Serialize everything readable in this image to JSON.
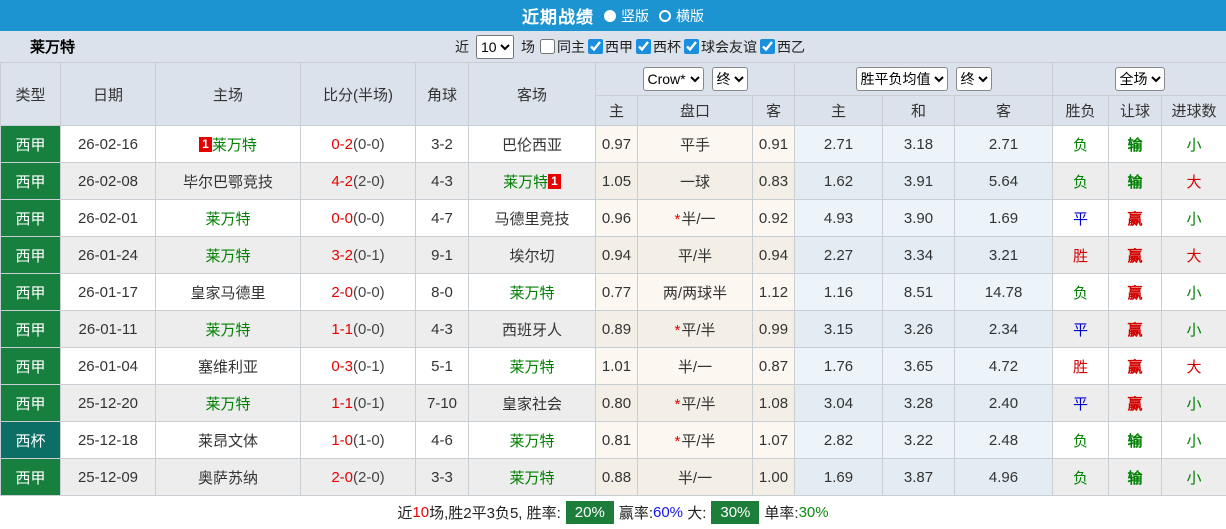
{
  "title_bar": {
    "title": "近期战绩",
    "layout_options": [
      {
        "label": "竖版",
        "selected": true
      },
      {
        "label": "横版",
        "selected": false
      }
    ]
  },
  "filter_bar": {
    "team": "莱万特",
    "recent_label": "近",
    "count_value": "10",
    "matches_label": "场",
    "filters": [
      {
        "label": "同主",
        "checked": false
      },
      {
        "label": "西甲",
        "checked": true
      },
      {
        "label": "西杯",
        "checked": true
      },
      {
        "label": "球会友谊",
        "checked": true
      },
      {
        "label": "西乙",
        "checked": true
      }
    ]
  },
  "table": {
    "static_headers": [
      "类型",
      "日期",
      "主场",
      "比分(半场)",
      "角球",
      "客场"
    ],
    "odds_group": {
      "selects": [
        "Crow*",
        "终"
      ],
      "columns": [
        "主",
        "盘口",
        "客"
      ]
    },
    "avg_group": {
      "selects": [
        "胜平负均值",
        "终"
      ],
      "columns": [
        "主",
        "和",
        "客"
      ]
    },
    "result_group": {
      "selects": [
        "全场"
      ],
      "columns": [
        "胜负",
        "让球",
        "进球数"
      ]
    },
    "rows": [
      {
        "league": "西甲",
        "league_color": "green",
        "date": "26-02-16",
        "home": {
          "name": "莱万特",
          "focus": true,
          "badge": "1",
          "badge_pos": "before"
        },
        "score": {
          "full": "0-2",
          "half": "(0-0)"
        },
        "corner": "3-2",
        "away": {
          "name": "巴伦西亚",
          "focus": false
        },
        "odds": {
          "home": "0.97",
          "star": false,
          "handicap": "平手",
          "away": "0.91"
        },
        "avg": {
          "home": "2.71",
          "draw": "3.18",
          "away": "2.71"
        },
        "outcome": {
          "text": "负",
          "color": "green"
        },
        "handicap_result": {
          "text": "输",
          "color": "green"
        },
        "goals_result": {
          "text": "小",
          "color": "green"
        }
      },
      {
        "league": "西甲",
        "league_color": "green",
        "date": "26-02-08",
        "home": {
          "name": "毕尔巴鄂竞技",
          "focus": false
        },
        "score": {
          "full": "4-2",
          "half": "(2-0)"
        },
        "corner": "4-3",
        "away": {
          "name": "莱万特",
          "focus": true,
          "badge": "1",
          "badge_pos": "after"
        },
        "odds": {
          "home": "1.05",
          "star": false,
          "handicap": "一球",
          "away": "0.83"
        },
        "avg": {
          "home": "1.62",
          "draw": "3.91",
          "away": "5.64"
        },
        "outcome": {
          "text": "负",
          "color": "green"
        },
        "handicap_result": {
          "text": "输",
          "color": "green"
        },
        "goals_result": {
          "text": "大",
          "color": "red"
        }
      },
      {
        "league": "西甲",
        "league_color": "green",
        "date": "26-02-01",
        "home": {
          "name": "莱万特",
          "focus": true
        },
        "score": {
          "full": "0-0",
          "half": "(0-0)"
        },
        "corner": "4-7",
        "away": {
          "name": "马德里竞技",
          "focus": false
        },
        "odds": {
          "home": "0.96",
          "star": true,
          "handicap": "半/一",
          "away": "0.92"
        },
        "avg": {
          "home": "4.93",
          "draw": "3.90",
          "away": "1.69"
        },
        "outcome": {
          "text": "平",
          "color": "blue"
        },
        "handicap_result": {
          "text": "赢",
          "color": "red"
        },
        "goals_result": {
          "text": "小",
          "color": "green"
        }
      },
      {
        "league": "西甲",
        "league_color": "green",
        "date": "26-01-24",
        "home": {
          "name": "莱万特",
          "focus": true
        },
        "score": {
          "full": "3-2",
          "half": "(0-1)"
        },
        "corner": "9-1",
        "away": {
          "name": "埃尔切",
          "focus": false
        },
        "odds": {
          "home": "0.94",
          "star": false,
          "handicap": "平/半",
          "away": "0.94"
        },
        "avg": {
          "home": "2.27",
          "draw": "3.34",
          "away": "3.21"
        },
        "outcome": {
          "text": "胜",
          "color": "red"
        },
        "handicap_result": {
          "text": "赢",
          "color": "red"
        },
        "goals_result": {
          "text": "大",
          "color": "red"
        }
      },
      {
        "league": "西甲",
        "league_color": "green",
        "date": "26-01-17",
        "home": {
          "name": "皇家马德里",
          "focus": false
        },
        "score": {
          "full": "2-0",
          "half": "(0-0)"
        },
        "corner": "8-0",
        "away": {
          "name": "莱万特",
          "focus": true
        },
        "odds": {
          "home": "0.77",
          "star": false,
          "handicap": "两/两球半",
          "away": "1.12"
        },
        "avg": {
          "home": "1.16",
          "draw": "8.51",
          "away": "14.78"
        },
        "outcome": {
          "text": "负",
          "color": "green"
        },
        "handicap_result": {
          "text": "赢",
          "color": "red"
        },
        "goals_result": {
          "text": "小",
          "color": "green"
        }
      },
      {
        "league": "西甲",
        "league_color": "green",
        "date": "26-01-11",
        "home": {
          "name": "莱万特",
          "focus": true
        },
        "score": {
          "full": "1-1",
          "half": "(0-0)"
        },
        "corner": "4-3",
        "away": {
          "name": "西班牙人",
          "focus": false
        },
        "odds": {
          "home": "0.89",
          "star": true,
          "handicap": "平/半",
          "away": "0.99"
        },
        "avg": {
          "home": "3.15",
          "draw": "3.26",
          "away": "2.34"
        },
        "outcome": {
          "text": "平",
          "color": "blue"
        },
        "handicap_result": {
          "text": "赢",
          "color": "red"
        },
        "goals_result": {
          "text": "小",
          "color": "green"
        }
      },
      {
        "league": "西甲",
        "league_color": "green",
        "date": "26-01-04",
        "home": {
          "name": "塞维利亚",
          "focus": false
        },
        "score": {
          "full": "0-3",
          "half": "(0-1)"
        },
        "corner": "5-1",
        "away": {
          "name": "莱万特",
          "focus": true
        },
        "odds": {
          "home": "1.01",
          "star": false,
          "handicap": "半/一",
          "away": "0.87"
        },
        "avg": {
          "home": "1.76",
          "draw": "3.65",
          "away": "4.72"
        },
        "outcome": {
          "text": "胜",
          "color": "red"
        },
        "handicap_result": {
          "text": "赢",
          "color": "red"
        },
        "goals_result": {
          "text": "大",
          "color": "red"
        }
      },
      {
        "league": "西甲",
        "league_color": "green",
        "date": "25-12-20",
        "home": {
          "name": "莱万特",
          "focus": true
        },
        "score": {
          "full": "1-1",
          "half": "(0-1)"
        },
        "corner": "7-10",
        "away": {
          "name": "皇家社会",
          "focus": false
        },
        "odds": {
          "home": "0.80",
          "star": true,
          "handicap": "平/半",
          "away": "1.08"
        },
        "avg": {
          "home": "3.04",
          "draw": "3.28",
          "away": "2.40"
        },
        "outcome": {
          "text": "平",
          "color": "blue"
        },
        "handicap_result": {
          "text": "赢",
          "color": "red"
        },
        "goals_result": {
          "text": "小",
          "color": "green"
        }
      },
      {
        "league": "西杯",
        "league_color": "teal",
        "date": "25-12-18",
        "home": {
          "name": "莱昂文体",
          "focus": false
        },
        "score": {
          "full": "1-0",
          "half": "(1-0)"
        },
        "corner": "4-6",
        "away": {
          "name": "莱万特",
          "focus": true
        },
        "odds": {
          "home": "0.81",
          "star": true,
          "handicap": "平/半",
          "away": "1.07"
        },
        "avg": {
          "home": "2.82",
          "draw": "3.22",
          "away": "2.48"
        },
        "outcome": {
          "text": "负",
          "color": "green"
        },
        "handicap_result": {
          "text": "输",
          "color": "green"
        },
        "goals_result": {
          "text": "小",
          "color": "green"
        }
      },
      {
        "league": "西甲",
        "league_color": "green",
        "date": "25-12-09",
        "home": {
          "name": "奥萨苏纳",
          "focus": false
        },
        "score": {
          "full": "2-0",
          "half": "(2-0)"
        },
        "corner": "3-3",
        "away": {
          "name": "莱万特",
          "focus": true
        },
        "odds": {
          "home": "0.88",
          "star": false,
          "handicap": "半/一",
          "away": "1.00"
        },
        "avg": {
          "home": "1.69",
          "draw": "3.87",
          "away": "4.96"
        },
        "outcome": {
          "text": "负",
          "color": "green"
        },
        "handicap_result": {
          "text": "输",
          "color": "green"
        },
        "goals_result": {
          "text": "小",
          "color": "green"
        }
      }
    ]
  },
  "summary": {
    "segments": [
      {
        "text": "近"
      },
      {
        "text": "10",
        "color": "red"
      },
      {
        "text": "场,胜2平3负5, 胜率:"
      },
      {
        "text": "20%",
        "badge": true
      },
      {
        "text": "赢率:"
      },
      {
        "text": "60%",
        "color": "blue"
      },
      {
        "text": " 大:"
      },
      {
        "text": "30%",
        "badge": true
      },
      {
        "text": "单率:"
      },
      {
        "text": "30%",
        "color": "green"
      }
    ]
  },
  "colors": {
    "title_bar": "#1d94d2",
    "panel_gray": "#dce2eb",
    "league_green": "#17803e",
    "league_teal": "#0c6f66",
    "focus_team": "#008000",
    "score_red": "#e60000",
    "win_red": "#d40000",
    "draw_blue": "#0000cc",
    "lose_green": "#008000",
    "summary_badge_green": "#1c7e3a"
  }
}
